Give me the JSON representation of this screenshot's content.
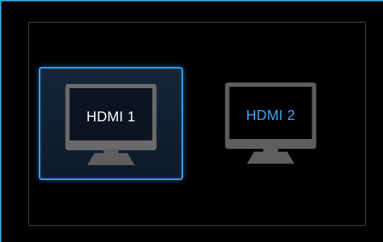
{
  "sources": [
    {
      "label": "HDMI 1",
      "selected": true
    },
    {
      "label": "HDMI 2",
      "selected": false
    }
  ],
  "colors": {
    "accent": "#3ea6ff",
    "window_border": "#2a9fd8",
    "panel_border": "#4a4a4a",
    "monitor": "#5e5e5e",
    "background": "#000000"
  },
  "icons": [
    "monitor-icon",
    "monitor-icon"
  ]
}
